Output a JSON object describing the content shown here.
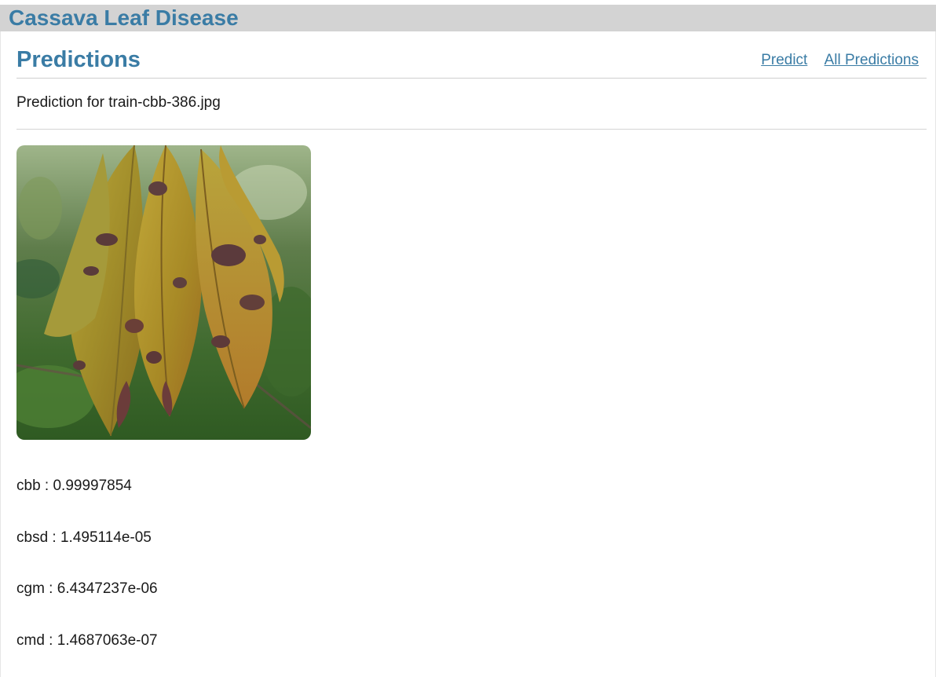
{
  "app": {
    "title": "Cassava Leaf Disease"
  },
  "page": {
    "title": "Predictions",
    "nav": [
      {
        "label": "Predict"
      },
      {
        "label": "All Predictions"
      }
    ]
  },
  "prediction": {
    "caption": "Prediction for train-cbb-386.jpg",
    "image_alt": "train-cbb-386.jpg",
    "results": [
      {
        "label": "cbb",
        "value": "0.99997854"
      },
      {
        "label": "cbsd",
        "value": "1.495114e-05"
      },
      {
        "label": "cgm",
        "value": "6.4347237e-06"
      },
      {
        "label": "cmd",
        "value": "1.4687063e-07"
      }
    ]
  },
  "colors": {
    "accent": "#3a7ca5",
    "header_bg": "#d3d3d3"
  }
}
